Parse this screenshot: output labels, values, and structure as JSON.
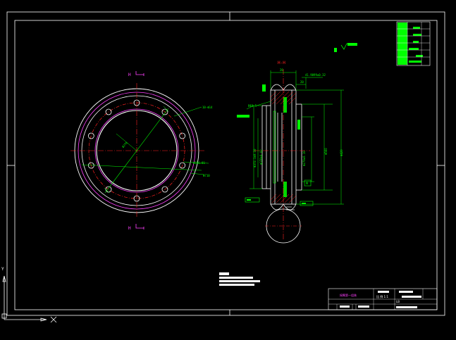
{
  "drawing": {
    "section_labels": {
      "top": "H",
      "bottom": "H",
      "view_title": "H-H"
    },
    "front_view": {
      "callouts": {
        "bolt_holes": "10-Φ14",
        "bolt_circle": "Φ326.81",
        "outer": "Φ710"
      }
    },
    "section_view": {
      "top_dims": [
        "26",
        "41.9099±0.32",
        "20"
      ],
      "radius": "R12.5",
      "vertical_dims": [
        "Φ372.1±0.10",
        "Φ378±0.02",
        "Φ270±0.10",
        "Φ560",
        "Φ420"
      ],
      "datum": "A"
    },
    "title_block_caption": "摇臂第一组装",
    "table_row_text": "比 例 1:1",
    "table_sub_text": "LB"
  },
  "colors": {
    "white": "#ffffff",
    "red": "#ff2020",
    "green": "#00ff00",
    "magenta": "#ff40ff",
    "cyan": "#00ffff",
    "yellow": "#ffff00"
  }
}
